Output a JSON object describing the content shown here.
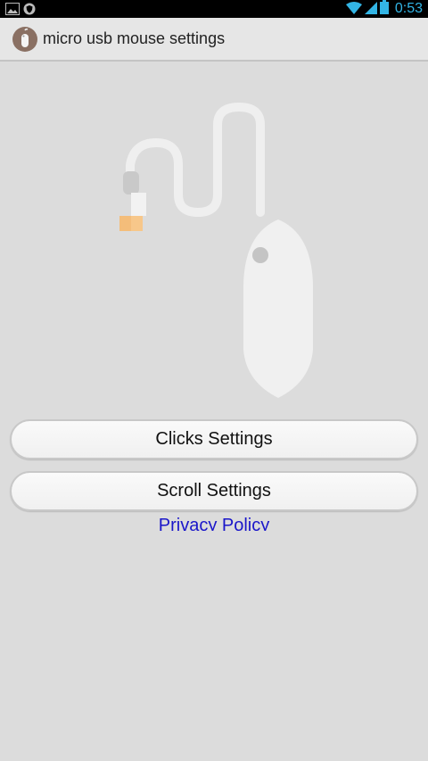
{
  "status_bar": {
    "time": "0:53",
    "icons": [
      "image-notification-icon",
      "shield-notification-icon",
      "wifi-icon",
      "signal-icon",
      "battery-icon"
    ],
    "accent": "#33b5e5"
  },
  "action_bar": {
    "title": "micro usb mouse settings",
    "icon": "mouse-app-icon"
  },
  "buttons": {
    "clicks": "Clicks Settings",
    "scroll": "Scroll Settings"
  },
  "privacy": {
    "label": "Privacy Policy",
    "color": "#1a16c9"
  },
  "colors": {
    "background": "#dcdcdc",
    "action_bar": "#e6e6e6"
  }
}
